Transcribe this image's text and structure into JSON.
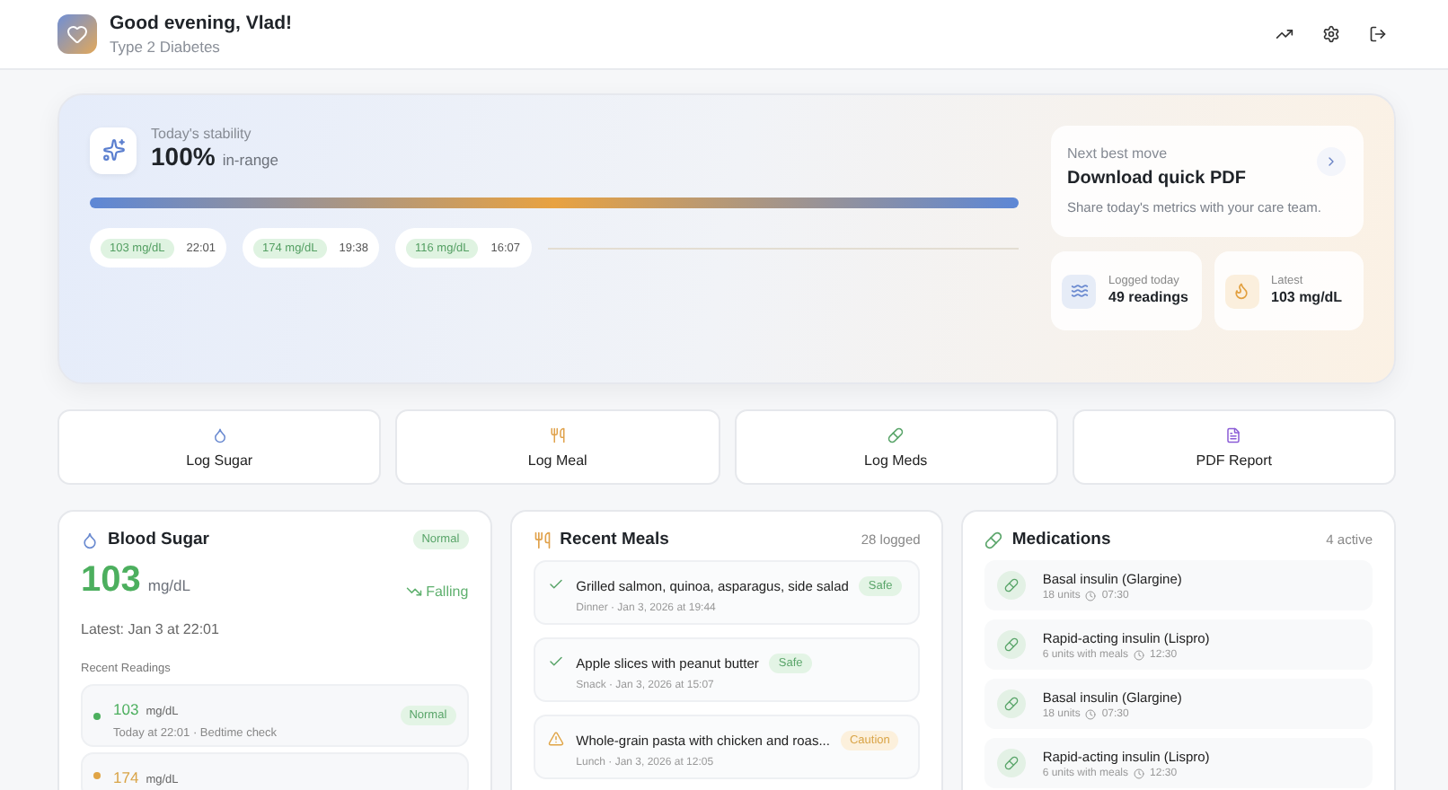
{
  "header": {
    "greeting": "Good evening, Vlad!",
    "subtitle": "Type 2 Diabetes"
  },
  "stability": {
    "label": "Today's stability",
    "value": "100%",
    "unit": "in-range",
    "readings": [
      {
        "value": "103 mg/dL",
        "time": "22:01"
      },
      {
        "value": "174 mg/dL",
        "time": "19:38"
      },
      {
        "value": "116 mg/dL",
        "time": "16:07"
      }
    ]
  },
  "next_move": {
    "eyebrow": "Next best move",
    "title": "Download quick PDF",
    "text": "Share today's metrics with your care team."
  },
  "stats": [
    {
      "kind": "logged",
      "label": "Logged today",
      "value": "49 readings"
    },
    {
      "kind": "latest",
      "label": "Latest",
      "value": "103 mg/dL"
    }
  ],
  "actions": [
    {
      "kind": "sugar",
      "label": "Log Sugar"
    },
    {
      "kind": "meal",
      "label": "Log Meal"
    },
    {
      "kind": "meds",
      "label": "Log Meds"
    },
    {
      "kind": "pdf",
      "label": "PDF Report"
    }
  ],
  "blood_sugar": {
    "title": "Blood Sugar",
    "status": "Normal",
    "value": "103",
    "unit": "mg/dL",
    "trend": "Falling",
    "latest": "Latest: Jan 3 at 22:01",
    "readings_title": "Recent Readings",
    "readings": [
      {
        "kind": "normal",
        "value": "103",
        "unit": "mg/dL",
        "detail": "Today at 22:01 · Bedtime check",
        "status": "Normal"
      },
      {
        "kind": "high",
        "value": "174",
        "unit": "mg/dL"
      }
    ]
  },
  "meals": {
    "title": "Recent Meals",
    "count": "28 logged",
    "items": [
      {
        "kind": "safe",
        "name": "Grilled salmon, quinoa, asparagus, side salad",
        "tag": "Safe",
        "detail": "Dinner · Jan 3, 2026 at 19:44"
      },
      {
        "kind": "safe",
        "name": "Apple slices with peanut butter",
        "tag": "Safe",
        "detail": "Snack · Jan 3, 2026 at 15:07"
      },
      {
        "kind": "caution",
        "name": "Whole-grain pasta with chicken and roas...",
        "tag": "Caution",
        "detail": "Lunch · Jan 3, 2026 at 12:05"
      }
    ]
  },
  "medications": {
    "title": "Medications",
    "count": "4 active",
    "items": [
      {
        "name": "Basal insulin (Glargine)",
        "dose": "18 units",
        "time": "07:30"
      },
      {
        "name": "Rapid-acting insulin (Lispro)",
        "dose": "6 units with meals",
        "time": "12:30"
      },
      {
        "name": "Basal insulin (Glargine)",
        "dose": "18 units",
        "time": "07:30"
      },
      {
        "name": "Rapid-acting insulin (Lispro)",
        "dose": "6 units with meals",
        "time": "12:30"
      }
    ]
  }
}
